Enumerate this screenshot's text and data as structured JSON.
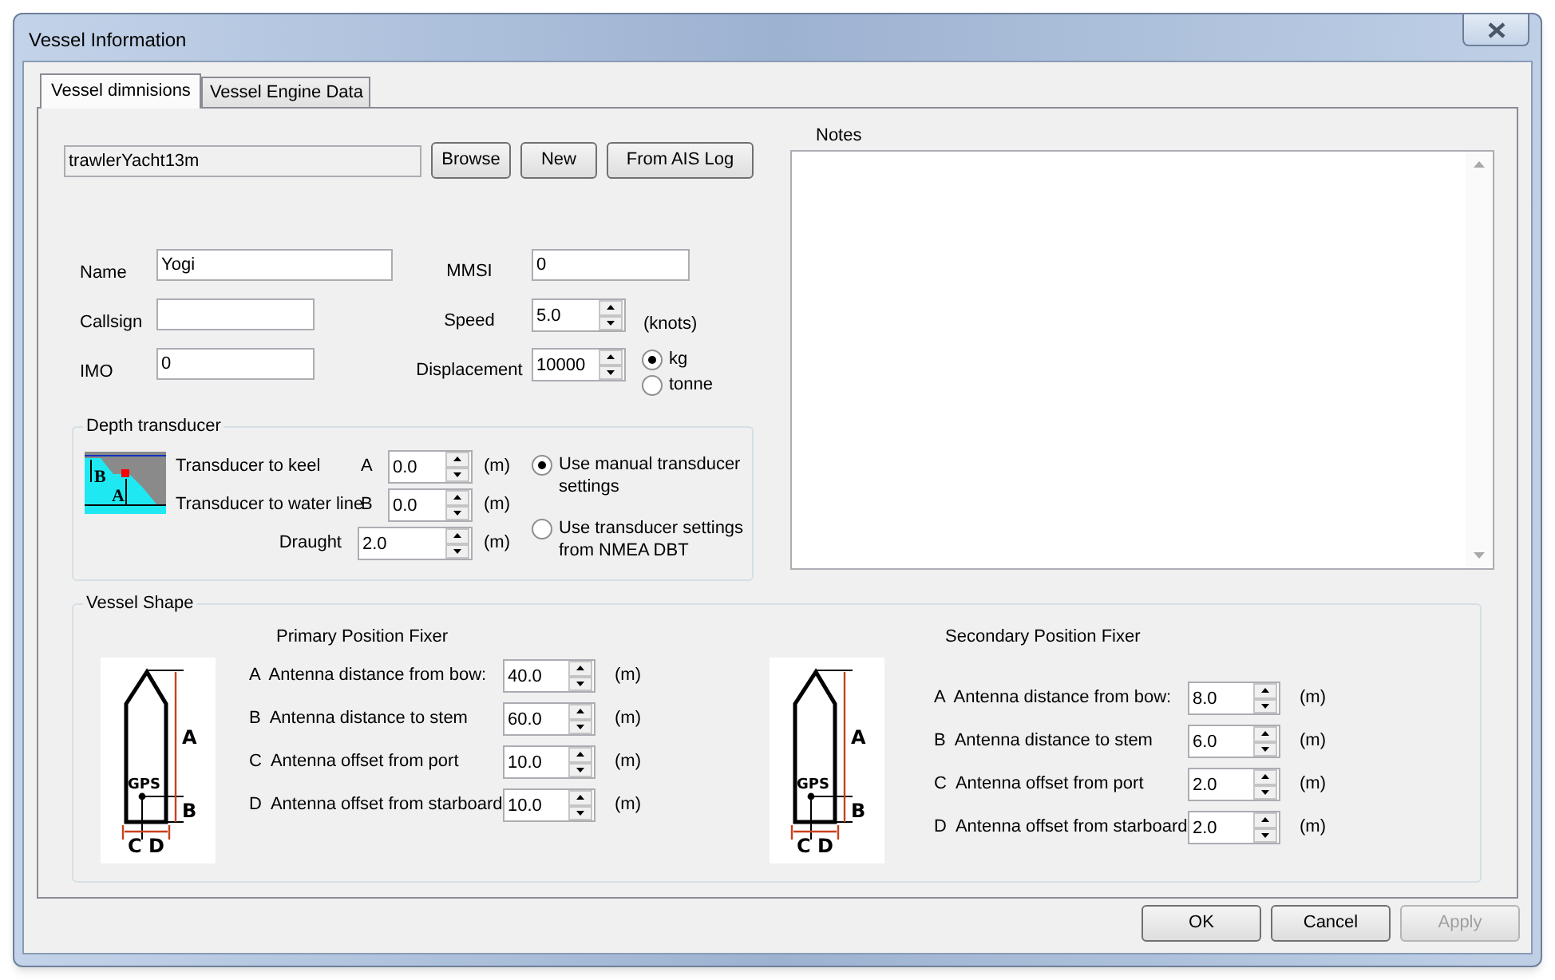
{
  "window": {
    "title": "Vessel Information"
  },
  "tabs": [
    {
      "label": "Vessel dimnisions",
      "selected": true
    },
    {
      "label": "Vessel Engine Data",
      "selected": false
    }
  ],
  "file": {
    "value": "trawlerYacht13m",
    "buttons": [
      "Browse",
      "New",
      "From AIS Log"
    ]
  },
  "left_fields": [
    {
      "label": "Name",
      "value": "Yogi"
    },
    {
      "label": "Callsign"
    },
    {
      "label": "IMO",
      "value": "0"
    }
  ],
  "right_fields": [
    {
      "kind": "text",
      "label": "MMSI",
      "value": "0"
    },
    {
      "kind": "spin",
      "label": "Speed",
      "value": "5.0",
      "unit": "(knots)"
    },
    {
      "kind": "spin",
      "label": "Displacement",
      "value": "10000"
    }
  ],
  "mass_units": [
    {
      "label": "kg",
      "selected": true
    },
    {
      "label": "tonne",
      "selected": false
    }
  ],
  "depth_transducer": {
    "title": "Depth transducer",
    "diagram_labels": [
      "B",
      "A"
    ],
    "fields": [
      {
        "label": "Transducer to keel",
        "letter": "A",
        "value": "0.0",
        "unit": "(m)"
      },
      {
        "label": "Transducer to water line",
        "letter": "B",
        "value": "0.0",
        "unit": "(m)"
      },
      {
        "label": "Draught",
        "value": "2.0",
        "unit": "(m)"
      }
    ],
    "options": [
      {
        "label": "Use manual transducer settings",
        "selected": true
      },
      {
        "label": "Use transducer settings from NMEA DBT",
        "selected": false
      }
    ]
  },
  "notes": {
    "label": "Notes"
  },
  "vessel_shape": {
    "title": "Vessel Shape",
    "fixers": [
      {
        "title": "Primary Position Fixer",
        "diagram_labels": [
          "A",
          "B",
          "GPS",
          "C",
          "D"
        ],
        "fields": [
          {
            "label": "A  Antenna distance from bow:",
            "value": "40.0",
            "unit": "(m)"
          },
          {
            "label": "B  Antenna distance to stem",
            "value": "60.0",
            "unit": "(m)"
          },
          {
            "label": "C  Antenna offset from port",
            "value": "10.0",
            "unit": "(m)"
          },
          {
            "label": "D  Antenna offset from starboard",
            "value": "10.0",
            "unit": "(m)"
          }
        ]
      },
      {
        "title": "Secondary Position Fixer",
        "diagram_labels": [
          "A",
          "B",
          "GPS",
          "C",
          "D"
        ],
        "fields": [
          {
            "label": "A  Antenna distance from bow:",
            "value": "8.0",
            "unit": "(m)"
          },
          {
            "label": "B  Antenna distance to stem",
            "value": "6.0",
            "unit": "(m)"
          },
          {
            "label": "C  Antenna offset from port",
            "value": "2.0",
            "unit": "(m)"
          },
          {
            "label": "D  Antenna offset from starboard",
            "value": "2.0",
            "unit": "(m)"
          }
        ]
      }
    ]
  },
  "dialog_buttons": [
    {
      "label": "OK",
      "disabled": false
    },
    {
      "label": "Cancel",
      "disabled": false
    },
    {
      "label": "Apply",
      "disabled": true
    }
  ]
}
